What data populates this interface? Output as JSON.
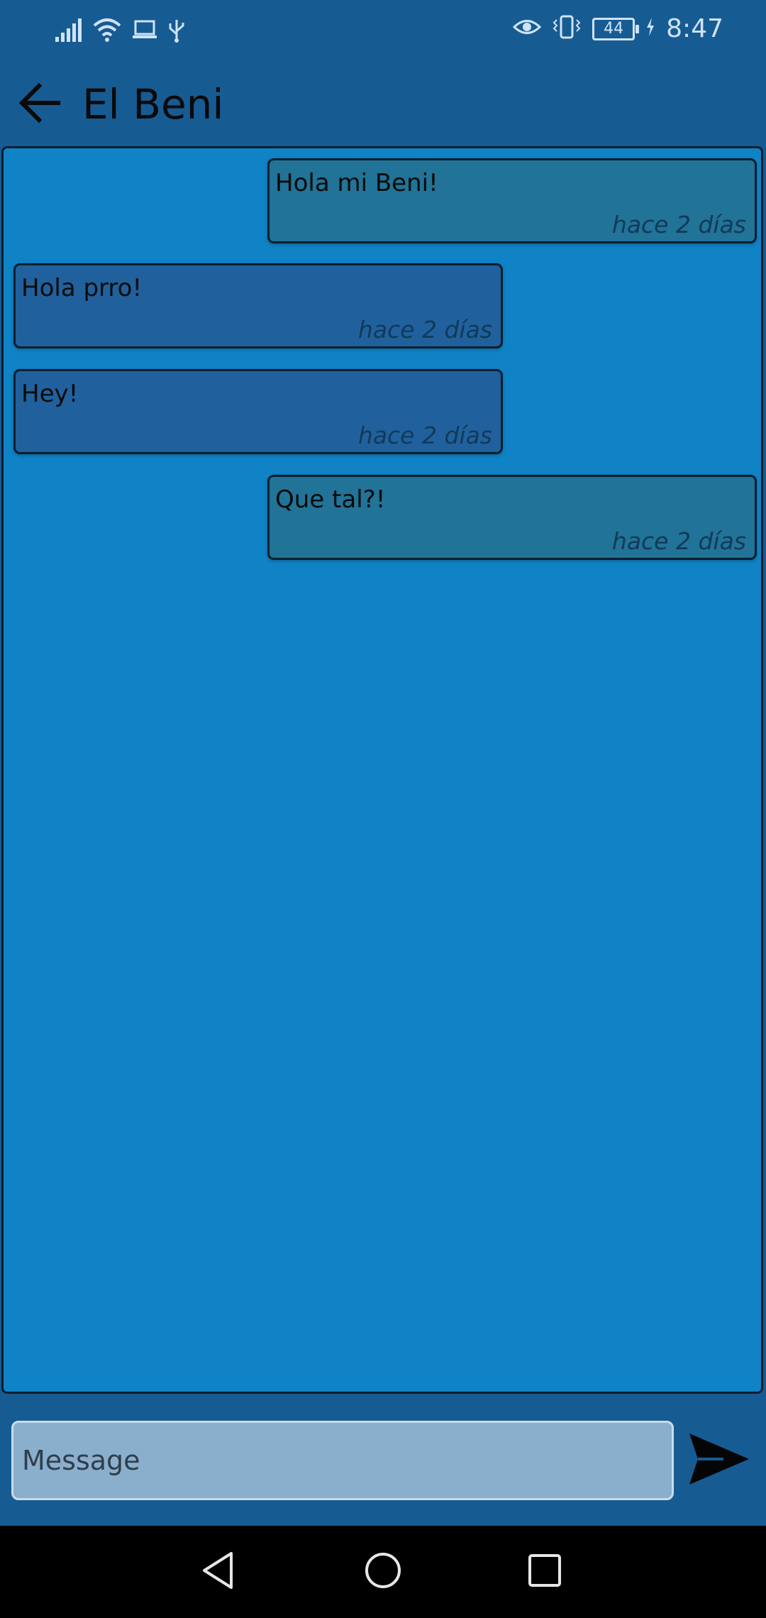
{
  "status_bar": {
    "time": "8:47",
    "battery": "44"
  },
  "header": {
    "title": "El Beni"
  },
  "messages": [
    {
      "text": "Hola mi Beni!",
      "time": "hace 2 días",
      "direction": "sent"
    },
    {
      "text": "Hola prro!",
      "time": "hace 2 días",
      "direction": "received"
    },
    {
      "text": "Hey!",
      "time": "hace 2 días",
      "direction": "received"
    },
    {
      "text": "Que tal?!",
      "time": "hace 2 días",
      "direction": "sent"
    }
  ],
  "composer": {
    "placeholder": "Message"
  },
  "colors": {
    "app_bar": "#175b93",
    "chat_background": "#0f83c6",
    "sent_bubble": "#217397",
    "received_bubble": "#20619d"
  },
  "icons": {
    "back": "arrow-left-icon",
    "send": "send-icon",
    "nav_back": "triangle-back-icon",
    "nav_home": "circle-home-icon",
    "nav_recents": "square-recents-icon"
  }
}
